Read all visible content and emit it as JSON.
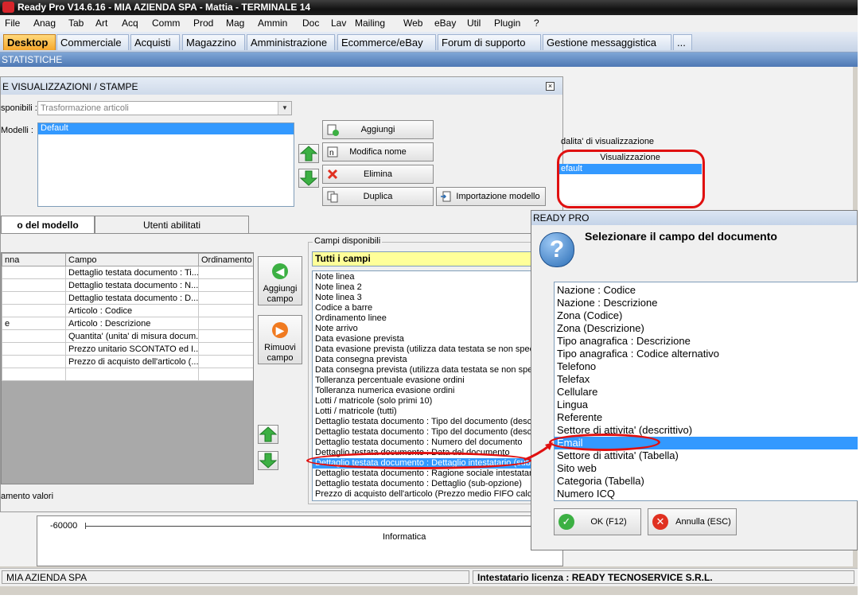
{
  "window": {
    "title": "Ready Pro V14.6.16 - MIA AZIENDA SPA - Mattia - TERMINALE 14"
  },
  "menu": [
    "File",
    "Anag",
    "Tab",
    "Art",
    "Acq",
    "Comm",
    "Prod",
    "Mag",
    "Ammin",
    "Doc",
    "Lav",
    "Mailing",
    "Web",
    "eBay",
    "Util",
    "Plugin",
    "?"
  ],
  "app_tabs": [
    "Desktop",
    "Commerciale",
    "Acquisti",
    "Magazzino",
    "Amministrazione",
    "Ecommerce/eBay",
    "Forum di supporto",
    "Gestione messaggistica",
    "..."
  ],
  "section_title": "STATISTICHE",
  "models_dialog": {
    "title": "E VISUALIZZAZIONI / STAMPE",
    "available_label": "sponibili :",
    "available_value": "Trasformazione articoli",
    "models_label": "Modelli :",
    "models": [
      "Default"
    ],
    "buttons": {
      "add": "Aggiungi",
      "rename": "Modifica nome",
      "delete": "Elimina",
      "duplicate": "Duplica",
      "import": "Importazione modello"
    },
    "display_mode_label": "dalita' di visualizzazione",
    "display_header": "Visualizzazione",
    "display_items": [
      "efault"
    ],
    "tabs": [
      "o del modello",
      "Utenti abilitati"
    ],
    "grid": {
      "headers": [
        "nna",
        "Campo",
        "Ordinamento"
      ],
      "rows": [
        [
          "",
          "Dettaglio testata documento : Ti...",
          ""
        ],
        [
          "",
          "Dettaglio testata documento : N...",
          ""
        ],
        [
          "",
          "Dettaglio testata documento : D...",
          ""
        ],
        [
          "",
          "Articolo : Codice",
          ""
        ],
        [
          "e",
          "Articolo : Descrizione",
          ""
        ],
        [
          "",
          "Quantita' (unita' di misura docum...",
          ""
        ],
        [
          "",
          "Prezzo unitario SCONTATO ed I...",
          ""
        ],
        [
          "",
          "Prezzo di acquisto dell'articolo (...",
          ""
        ],
        [
          "",
          "",
          ""
        ]
      ]
    },
    "add_field_label": "Aggiungi campo",
    "remove_field_label": "Rimuovi campo",
    "sort_values_label": "amento valori",
    "fields_group_label": "Campi disponibili",
    "fields_filter": "Tutti i campi",
    "fields": [
      "Note linea",
      "Note linea 2",
      "Note linea 3",
      "Codice a barre",
      "Ordinamento linee",
      "Note arrivo",
      "Data evasione prevista",
      "Data evasione prevista (utilizza data testata se non specif",
      "Data consegna prevista",
      "Data consegna prevista (utilizza data testata se non spec",
      "Tolleranza percentuale evasione ordini",
      "Tolleranza numerica evasione ordini",
      "Lotti / matricole (solo primi 10)",
      "Lotti / matricole (tutti)",
      "Dettaglio testata documento : Tipo del documento (descri",
      "Dettaglio testata documento : Tipo del documento (descri",
      "Dettaglio testata documento : Numero del documento",
      "Dettaglio testata documento : Data del documento",
      "Dettaglio testata documento : Dettaglio intestatario (sub-o",
      "Dettaglio testata documento : Ragione sociale intestatari",
      "Dettaglio testata documento : Dettaglio (sub-opzione)",
      "Prezzo di acquisto dell'articolo (Prezzo medio FIFO calcola"
    ],
    "selected_field_index": 18
  },
  "background_chart": {
    "tick": "-60000",
    "category": "Informatica"
  },
  "select_dialog": {
    "title": "READY PRO",
    "question": "Selezionare il campo del documento",
    "items": [
      "Nazione : Codice",
      "Nazione : Descrizione",
      "Zona (Codice)",
      "Zona (Descrizione)",
      "Tipo anagrafica : Descrizione",
      "Tipo anagrafica : Codice alternativo",
      "Telefono",
      "Telefax",
      "Cellulare",
      "Lingua",
      "Referente",
      "Settore di attivita' (descrittivo)",
      "Email",
      "Settore di attivita' (Tabella)",
      "Sito web",
      "Categoria (Tabella)",
      "Numero ICQ"
    ],
    "selected_index": 12,
    "ok": "OK (F12)",
    "cancel": "Annulla (ESC)"
  },
  "status": {
    "company": "MIA AZIENDA SPA",
    "license": "Intestatario licenza : READY TECNOSERVICE S.R.L."
  },
  "colors": {
    "selection": "#3399ff",
    "highlight": "#e01010",
    "filter_bg": "#ffff99"
  }
}
